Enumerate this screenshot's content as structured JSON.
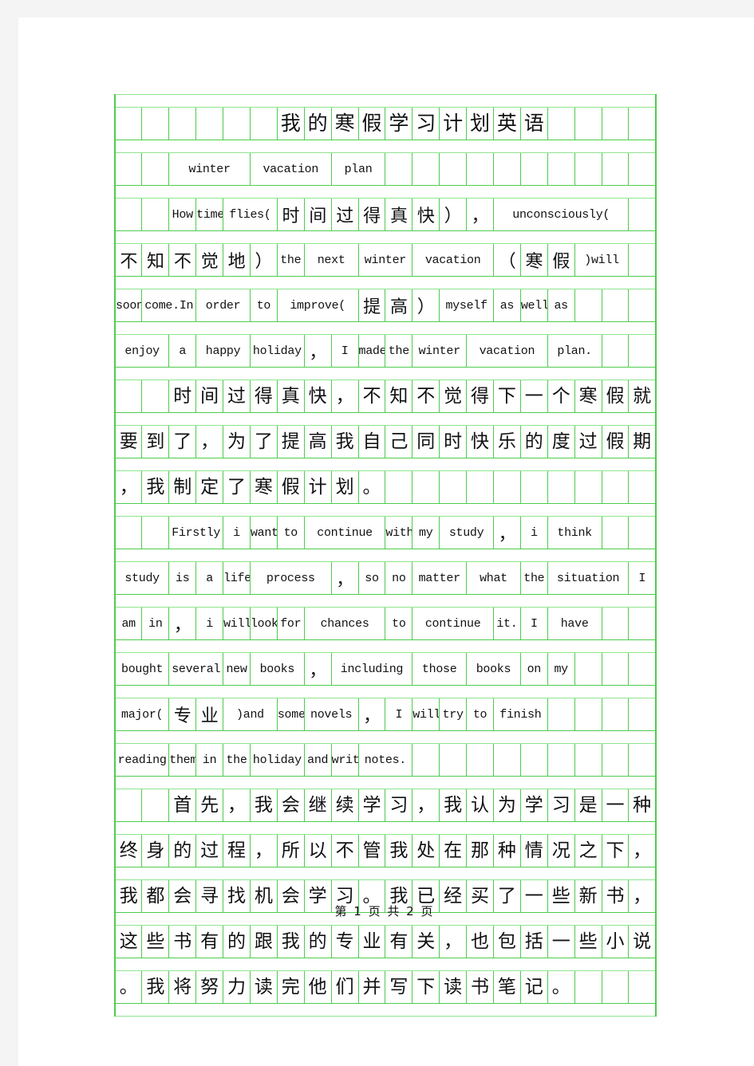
{
  "page": {
    "background_color": "#f4f4f4",
    "paper_color": "#ffffff",
    "grid_line_color": "#4ecb4e",
    "grid_line_light_color": "#8ee58e",
    "text_color": "#111111",
    "columns": 20
  },
  "footer": {
    "text": "第 1 页 共 2 页"
  },
  "document": {
    "title": "我的寒假学习计划英语",
    "subtitle": "winter vacation plan",
    "rows": [
      {
        "id": "row-title",
        "kind": "chinese",
        "indent": 6,
        "cells": [
          "我",
          "的",
          "寒",
          "假",
          "学",
          "习",
          "计",
          "划",
          "英",
          "语"
        ]
      },
      {
        "id": "row-subtitle",
        "kind": "english",
        "indent": 2,
        "segments": [
          {
            "text": "winter",
            "span": 3
          },
          {
            "text": "vacation",
            "span": 3
          },
          {
            "text": "plan",
            "span": 2
          }
        ]
      },
      {
        "id": "row-en-1",
        "kind": "mixed",
        "indent": 2,
        "segments": [
          {
            "text": "How",
            "span": 1
          },
          {
            "text": "time",
            "span": 1
          },
          {
            "text": "flies(",
            "span": 2
          },
          {
            "text": "时",
            "span": 1,
            "cn": true
          },
          {
            "text": "间",
            "span": 1,
            "cn": true
          },
          {
            "text": "过",
            "span": 1,
            "cn": true
          },
          {
            "text": "得",
            "span": 1,
            "cn": true
          },
          {
            "text": "真",
            "span": 1,
            "cn": true
          },
          {
            "text": "快",
            "span": 1,
            "cn": true
          },
          {
            "text": "）",
            "span": 1,
            "cn": true
          },
          {
            "text": "，",
            "span": 1,
            "cn": true
          },
          {
            "text": "unconsciously(",
            "span": 5
          }
        ]
      },
      {
        "id": "row-en-2",
        "kind": "mixed",
        "indent": 0,
        "segments": [
          {
            "text": "不",
            "span": 1,
            "cn": true
          },
          {
            "text": "知",
            "span": 1,
            "cn": true
          },
          {
            "text": "不",
            "span": 1,
            "cn": true
          },
          {
            "text": "觉",
            "span": 1,
            "cn": true
          },
          {
            "text": "地",
            "span": 1,
            "cn": true
          },
          {
            "text": "）",
            "span": 1,
            "cn": true
          },
          {
            "text": "the",
            "span": 1
          },
          {
            "text": "next",
            "span": 2
          },
          {
            "text": "winter",
            "span": 2
          },
          {
            "text": "vacation",
            "span": 3
          },
          {
            "text": "（",
            "span": 1,
            "cn": true
          },
          {
            "text": "寒",
            "span": 1,
            "cn": true
          },
          {
            "text": "假",
            "span": 1,
            "cn": true
          },
          {
            "text": ")will",
            "span": 2
          }
        ]
      },
      {
        "id": "row-en-3",
        "kind": "mixed",
        "indent": 0,
        "segments": [
          {
            "text": "soon",
            "span": 1
          },
          {
            "text": "come.In",
            "span": 2
          },
          {
            "text": "order",
            "span": 2
          },
          {
            "text": "to",
            "span": 1
          },
          {
            "text": "improve(",
            "span": 3
          },
          {
            "text": "提",
            "span": 1,
            "cn": true
          },
          {
            "text": "高",
            "span": 1,
            "cn": true
          },
          {
            "text": "）",
            "span": 1,
            "cn": true
          },
          {
            "text": "myself",
            "span": 2
          },
          {
            "text": "as",
            "span": 1
          },
          {
            "text": "well",
            "span": 1
          },
          {
            "text": "as",
            "span": 1
          }
        ]
      },
      {
        "id": "row-en-4",
        "kind": "english",
        "indent": 0,
        "segments": [
          {
            "text": "enjoy",
            "span": 2
          },
          {
            "text": "a",
            "span": 1
          },
          {
            "text": "happy",
            "span": 2
          },
          {
            "text": "holiday",
            "span": 2
          },
          {
            "text": "，",
            "span": 1,
            "cn": true
          },
          {
            "text": "I",
            "span": 1
          },
          {
            "text": "made",
            "span": 1
          },
          {
            "text": "the",
            "span": 1
          },
          {
            "text": "winter",
            "span": 2
          },
          {
            "text": "vacation",
            "span": 3
          },
          {
            "text": "plan.",
            "span": 2
          }
        ]
      },
      {
        "id": "row-cn-1",
        "kind": "chinese",
        "indent": 2,
        "cells": [
          "时",
          "间",
          "过",
          "得",
          "真",
          "快",
          "，",
          "不",
          "知",
          "不",
          "觉",
          "得",
          "下",
          "一",
          "个",
          "寒",
          "假",
          "就"
        ]
      },
      {
        "id": "row-cn-2",
        "kind": "chinese",
        "indent": 0,
        "cells": [
          "要",
          "到",
          "了",
          "，",
          "为",
          "了",
          "提",
          "高",
          "我",
          "自",
          "己",
          "同",
          "时",
          "快",
          "乐",
          "的",
          "度",
          "过",
          "假",
          "期"
        ]
      },
      {
        "id": "row-cn-3",
        "kind": "chinese",
        "indent": 0,
        "cells": [
          "，",
          "我",
          "制",
          "定",
          "了",
          "寒",
          "假",
          "计",
          "划",
          "。"
        ]
      },
      {
        "id": "row-en-5",
        "kind": "english",
        "indent": 2,
        "segments": [
          {
            "text": "Firstly",
            "span": 2
          },
          {
            "text": "i",
            "span": 1
          },
          {
            "text": "want",
            "span": 1
          },
          {
            "text": "to",
            "span": 1
          },
          {
            "text": "continue",
            "span": 3
          },
          {
            "text": "with",
            "span": 1
          },
          {
            "text": "my",
            "span": 1
          },
          {
            "text": "study",
            "span": 2
          },
          {
            "text": "，",
            "span": 1,
            "cn": true
          },
          {
            "text": "i",
            "span": 1
          },
          {
            "text": "think",
            "span": 2
          }
        ]
      },
      {
        "id": "row-en-6",
        "kind": "english",
        "indent": 0,
        "segments": [
          {
            "text": "study",
            "span": 2
          },
          {
            "text": "is",
            "span": 1
          },
          {
            "text": "a",
            "span": 1
          },
          {
            "text": "life",
            "span": 1
          },
          {
            "text": "process",
            "span": 3
          },
          {
            "text": "，",
            "span": 1,
            "cn": true
          },
          {
            "text": "so",
            "span": 1
          },
          {
            "text": "no",
            "span": 1
          },
          {
            "text": "matter",
            "span": 2
          },
          {
            "text": "what",
            "span": 2
          },
          {
            "text": "the",
            "span": 1
          },
          {
            "text": "situation",
            "span": 3
          },
          {
            "text": "I",
            "span": 1
          }
        ]
      },
      {
        "id": "row-en-7",
        "kind": "english",
        "indent": 0,
        "segments": [
          {
            "text": "am",
            "span": 1
          },
          {
            "text": "in",
            "span": 1
          },
          {
            "text": "，",
            "span": 1,
            "cn": true
          },
          {
            "text": "i",
            "span": 1
          },
          {
            "text": "will",
            "span": 1
          },
          {
            "text": "look",
            "span": 1
          },
          {
            "text": "for",
            "span": 1
          },
          {
            "text": "chances",
            "span": 3
          },
          {
            "text": "to",
            "span": 1
          },
          {
            "text": "continue",
            "span": 3
          },
          {
            "text": "it.",
            "span": 1
          },
          {
            "text": "I",
            "span": 0
          },
          {
            "text": "have",
            "span": 2
          }
        ]
      },
      {
        "id": "row-en-8",
        "kind": "english",
        "indent": 0,
        "segments": [
          {
            "text": "bought",
            "span": 2
          },
          {
            "text": "several",
            "span": 2
          },
          {
            "text": "new",
            "span": 1
          },
          {
            "text": "books",
            "span": 2
          },
          {
            "text": "，",
            "span": 1,
            "cn": true
          },
          {
            "text": "including",
            "span": 3
          },
          {
            "text": "those",
            "span": 2
          },
          {
            "text": "books",
            "span": 2
          },
          {
            "text": "on",
            "span": 1
          },
          {
            "text": "my",
            "span": 1
          }
        ]
      },
      {
        "id": "row-en-9",
        "kind": "english",
        "indent": 0,
        "segments": [
          {
            "text": "major(",
            "span": 2
          },
          {
            "text": "专",
            "span": 1,
            "cn": true
          },
          {
            "text": "业",
            "span": 1,
            "cn": true
          },
          {
            "text": ")and",
            "span": 2
          },
          {
            "text": "some",
            "span": 1
          },
          {
            "text": "novels",
            "span": 2
          },
          {
            "text": "，",
            "span": 1,
            "cn": true
          },
          {
            "text": "I",
            "span": 1
          },
          {
            "text": "will",
            "span": 1
          },
          {
            "text": "try",
            "span": 1
          },
          {
            "text": "to",
            "span": 1
          },
          {
            "text": "finish",
            "span": 2
          }
        ]
      },
      {
        "id": "row-en-10",
        "kind": "english",
        "indent": 0,
        "segments": [
          {
            "text": "reading",
            "span": 2
          },
          {
            "text": "them",
            "span": 1
          },
          {
            "text": "in",
            "span": 1
          },
          {
            "text": "the",
            "span": 1
          },
          {
            "text": "holiday",
            "span": 2
          },
          {
            "text": "and",
            "span": 1
          },
          {
            "text": "write",
            "span": 1
          },
          {
            "text": "notes.",
            "span": 2
          }
        ]
      },
      {
        "id": "row-cn-4",
        "kind": "chinese",
        "indent": 2,
        "cells": [
          "首",
          "先",
          "，",
          "我",
          "会",
          "继",
          "续",
          "学",
          "习",
          "，",
          "我",
          "认",
          "为",
          "学",
          "习",
          "是",
          "一",
          "种"
        ]
      },
      {
        "id": "row-cn-5",
        "kind": "chinese",
        "indent": 0,
        "cells": [
          "终",
          "身",
          "的",
          "过",
          "程",
          "，",
          "所",
          "以",
          "不",
          "管",
          "我",
          "处",
          "在",
          "那",
          "种",
          "情",
          "况",
          "之",
          "下",
          "，"
        ]
      },
      {
        "id": "row-cn-6",
        "kind": "chinese",
        "indent": 0,
        "cells": [
          "我",
          "都",
          "会",
          "寻",
          "找",
          "机",
          "会",
          "学",
          "习",
          "。",
          "我",
          "已",
          "经",
          "买",
          "了",
          "一",
          "些",
          "新",
          "书",
          "，"
        ]
      },
      {
        "id": "row-cn-7",
        "kind": "chinese",
        "indent": 0,
        "cells": [
          "这",
          "些",
          "书",
          "有",
          "的",
          "跟",
          "我",
          "的",
          "专",
          "业",
          "有",
          "关",
          "，",
          "也",
          "包",
          "括",
          "一",
          "些",
          "小",
          "说"
        ]
      },
      {
        "id": "row-cn-8",
        "kind": "chinese",
        "indent": 0,
        "cells": [
          "。",
          "我",
          "将",
          "努",
          "力",
          "读",
          "完",
          "他",
          "们",
          "并",
          "写",
          "下",
          "读",
          "书",
          "笔",
          "记",
          "。"
        ]
      }
    ]
  }
}
